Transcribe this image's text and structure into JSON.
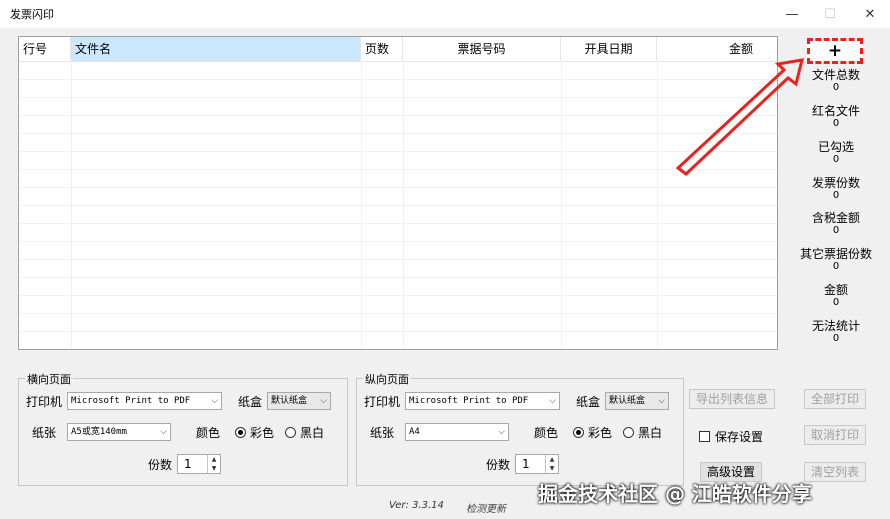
{
  "window": {
    "title": "发票闪印",
    "controls": {
      "minimize": "—",
      "maximize": "☐",
      "close": "✕"
    }
  },
  "grid": {
    "headers": [
      "行号",
      "文件名",
      "页数",
      "票据号码",
      "开具日期",
      "金额"
    ]
  },
  "add_button": {
    "label": "+"
  },
  "stats": [
    {
      "label": "文件总数",
      "value": "0"
    },
    {
      "label": "红名文件",
      "value": "0"
    },
    {
      "label": "已勾选",
      "value": "0"
    },
    {
      "label": "发票份数",
      "value": "0"
    },
    {
      "label": "含税金额",
      "value": "0"
    },
    {
      "label": "其它票据份数",
      "value": "0"
    },
    {
      "label": "金额",
      "value": "0"
    },
    {
      "label": "无法统计",
      "value": "0"
    }
  ],
  "landscape": {
    "legend": "横向页面",
    "printer_label": "打印机",
    "printer_value": "Microsoft Print to PDF",
    "tray_label": "纸盒",
    "tray_value": "默认纸盒",
    "paper_label": "纸张",
    "paper_value": "A5或宽140mm",
    "color_label": "颜色",
    "color_option": "彩色",
    "bw_option": "黑白",
    "copies_label": "份数",
    "copies_value": "1"
  },
  "portrait": {
    "legend": "纵向页面",
    "printer_label": "打印机",
    "printer_value": "Microsoft Print to PDF",
    "tray_label": "纸盒",
    "tray_value": "默认纸盒",
    "paper_label": "纸张",
    "paper_value": "A4",
    "color_label": "颜色",
    "color_option": "彩色",
    "bw_option": "黑白",
    "copies_label": "份数",
    "copies_value": "1"
  },
  "actions": {
    "export_list": "导出列表信息",
    "print_all": "全部打印",
    "save_settings": "保存设置",
    "cancel_print": "取消打印",
    "advanced": "高级设置",
    "clear_list": "清空列表"
  },
  "footer": {
    "version": "Ver: 3.3.14",
    "check_update": "检测更新"
  },
  "watermark": "掘金技术社区 @ 江皓软件分享",
  "colors": {
    "accent": "#e8231e",
    "selected_header": "#cce8ff",
    "background": "#f0f0f0"
  }
}
